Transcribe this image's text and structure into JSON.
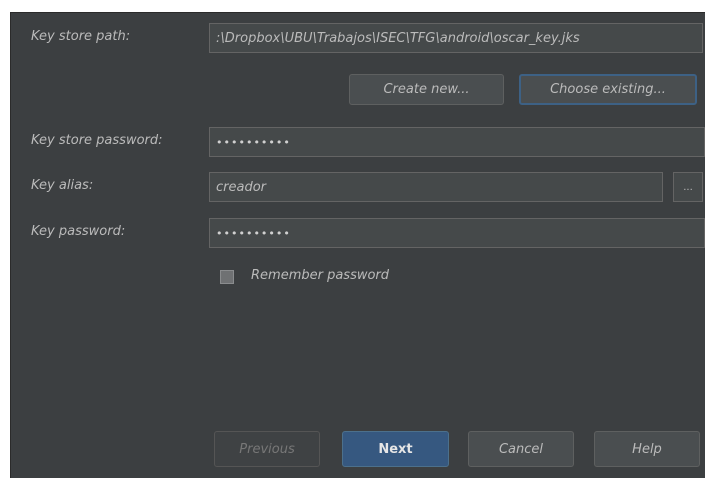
{
  "form": {
    "keystore_path_label": "Key store path:",
    "keystore_path_value": ":\\Dropbox\\UBU\\Trabajos\\ISEC\\TFG\\android\\oscar_key.jks",
    "create_new_label": "Create new...",
    "choose_existing_label": "Choose existing...",
    "keystore_password_label": "Key store password:",
    "keystore_password_value": "••••••••••",
    "key_alias_label": "Key alias:",
    "key_alias_value": "creador",
    "browse_label": "...",
    "key_password_label": "Key password:",
    "key_password_value": "••••••••••",
    "remember_password_label": "Remember password",
    "remember_password_checked": false
  },
  "footer": {
    "previous_label": "Previous",
    "next_label": "Next",
    "cancel_label": "Cancel",
    "help_label": "Help"
  }
}
